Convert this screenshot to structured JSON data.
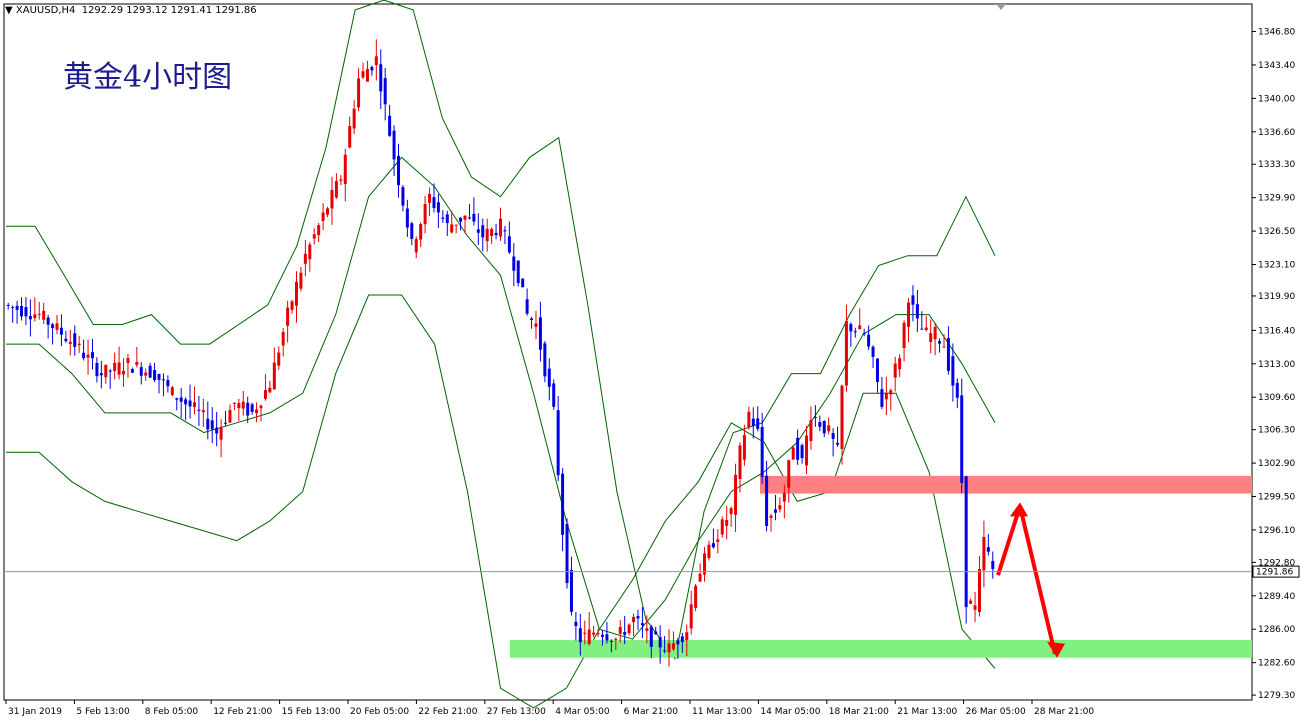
{
  "header": {
    "symbol": "XAUUSD,H4",
    "ohlc": "1292.29 1293.12 1291.41 1291.86"
  },
  "chart_data": {
    "type": "candlestick",
    "title": "黄金4小时图",
    "symbol": "XAUUSD",
    "timeframe": "H4",
    "current_price": "1291.86",
    "yticks": [
      "1346.80",
      "1343.40",
      "1340.00",
      "1336.60",
      "1333.30",
      "1329.90",
      "1326.50",
      "1323.10",
      "1319.90",
      "1316.40",
      "1313.00",
      "1309.60",
      "1306.30",
      "1302.90",
      "1299.50",
      "1296.10",
      "1292.80",
      "1289.40",
      "1286.00",
      "1282.60",
      "1279.30"
    ],
    "ylim": [
      1278.8,
      1349.6
    ],
    "xticks": [
      "31 Jan 2019",
      "5 Feb 13:00",
      "8 Feb 05:00",
      "12 Feb 21:00",
      "15 Feb 13:00",
      "20 Feb 05:00",
      "22 Feb 21:00",
      "27 Feb 13:00",
      "4 Mar 05:00",
      "6 Mar 21:00",
      "11 Mar 13:00",
      "14 Mar 05:00",
      "18 Mar 21:00",
      "21 Mar 13:00",
      "26 Mar 05:00",
      "28 Mar 21:00"
    ],
    "path_points": [
      [
        0,
        1319
      ],
      [
        8,
        1318
      ],
      [
        16,
        1315
      ],
      [
        22,
        1312
      ],
      [
        28,
        1313
      ],
      [
        34,
        1312
      ],
      [
        38,
        1310
      ],
      [
        44,
        1308
      ],
      [
        48,
        1306
      ],
      [
        52,
        1309
      ],
      [
        56,
        1308
      ],
      [
        60,
        1311
      ],
      [
        64,
        1318
      ],
      [
        68,
        1324
      ],
      [
        72,
        1328
      ],
      [
        76,
        1332
      ],
      [
        80,
        1342
      ],
      [
        84,
        1344
      ],
      [
        88,
        1334
      ],
      [
        92,
        1325
      ],
      [
        96,
        1330
      ],
      [
        100,
        1327
      ],
      [
        104,
        1328
      ],
      [
        108,
        1326
      ],
      [
        112,
        1327
      ],
      [
        116,
        1322
      ],
      [
        118,
        1318
      ],
      [
        120,
        1317
      ],
      [
        124,
        1308
      ],
      [
        126,
        1296
      ],
      [
        128,
        1287
      ],
      [
        130,
        1285
      ],
      [
        134,
        1286
      ],
      [
        138,
        1285
      ],
      [
        142,
        1287
      ],
      [
        146,
        1285
      ],
      [
        150,
        1284
      ],
      [
        154,
        1286
      ],
      [
        156,
        1291
      ],
      [
        160,
        1295
      ],
      [
        164,
        1298
      ],
      [
        166,
        1304
      ],
      [
        168,
        1308
      ],
      [
        170,
        1306
      ],
      [
        172,
        1297
      ],
      [
        174,
        1298
      ],
      [
        176,
        1300
      ],
      [
        178,
        1305
      ],
      [
        180,
        1303
      ],
      [
        182,
        1308
      ],
      [
        186,
        1306
      ],
      [
        188,
        1304
      ],
      [
        190,
        1317
      ],
      [
        194,
        1316
      ],
      [
        196,
        1313
      ],
      [
        198,
        1309
      ],
      [
        200,
        1311
      ],
      [
        202,
        1314
      ],
      [
        204,
        1320
      ],
      [
        206,
        1317
      ],
      [
        208,
        1316
      ],
      [
        210,
        1316
      ],
      [
        212,
        1315
      ],
      [
        214,
        1311
      ],
      [
        215,
        1309
      ],
      [
        216,
        1301
      ],
      [
        217,
        1289
      ],
      [
        219,
        1288
      ],
      [
        221,
        1295
      ],
      [
        223,
        1292
      ]
    ],
    "bollinger_bands": {
      "upper": [
        1327,
        1327,
        1322,
        1317,
        1317,
        1318,
        1315,
        1315,
        1317,
        1319,
        1325,
        1335,
        1349,
        1350,
        1349,
        1338,
        1332,
        1330,
        1334,
        1336,
        1319,
        1300,
        1287,
        1283,
        1298,
        1306,
        1307,
        1312,
        1312,
        1318,
        1323,
        1324,
        1324,
        1330,
        1324
      ],
      "middle": [
        1315,
        1315,
        1312,
        1308,
        1308,
        1308,
        1306,
        1307,
        1308,
        1310,
        1318,
        1330,
        1334,
        1331,
        1326,
        1322,
        1310,
        1297,
        1286,
        1285,
        1289,
        1295,
        1300,
        1302,
        1305,
        1310,
        1316,
        1318,
        1318,
        1313,
        1307
      ],
      "lower": [
        1304,
        1304,
        1301,
        1299,
        1298,
        1297,
        1296,
        1295,
        1297,
        1300,
        1312,
        1320,
        1320,
        1315,
        1300,
        1280,
        1278,
        1280,
        1286,
        1291,
        1297,
        1301,
        1307,
        1305,
        1299,
        1300,
        1310,
        1310,
        1302,
        1286,
        1282
      ]
    },
    "zones": {
      "resistance": {
        "from": 1299.8,
        "to": 1301.6,
        "color": "#ff8080"
      },
      "support": {
        "from": 1283.1,
        "to": 1284.9,
        "color": "#80f080"
      }
    },
    "projection": {
      "color": "#ff0000",
      "points": [
        [
          1291.5
        ],
        [
          1298.5
        ],
        [
          1283.5
        ]
      ]
    },
    "colors": {
      "bull": "#e60000",
      "bear": "#0000e6",
      "band": "#006400",
      "price_label_bg": "#ffffff"
    }
  }
}
